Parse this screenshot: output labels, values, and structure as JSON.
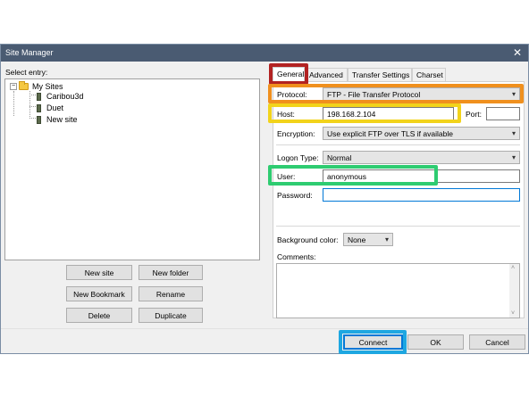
{
  "window": {
    "title": "Site Manager",
    "close_glyph": "✕"
  },
  "left": {
    "select_entry_label": "Select entry:",
    "tree": {
      "root": {
        "label": "My Sites",
        "expander": "−",
        "icon": "folder-icon"
      },
      "children": [
        {
          "label": "Caribou3d",
          "icon": "server-icon"
        },
        {
          "label": "Duet",
          "icon": "server-icon"
        },
        {
          "label": "New site",
          "icon": "server-icon"
        }
      ]
    },
    "buttons": {
      "new_site": "New site",
      "new_folder": "New folder",
      "new_bookmark": "New Bookmark",
      "rename": "Rename",
      "delete": "Delete",
      "duplicate": "Duplicate"
    }
  },
  "tabs": [
    "General",
    "Advanced",
    "Transfer Settings",
    "Charset"
  ],
  "general": {
    "protocol_label": "Protocol:",
    "protocol_value": "FTP - File Transfer Protocol",
    "host_label": "Host:",
    "host_value": "198.168.2.104",
    "port_label": "Port:",
    "port_value": "",
    "encryption_label": "Encryption:",
    "encryption_value": "Use explicit FTP over TLS if available",
    "logon_type_label": "Logon Type:",
    "logon_type_value": "Normal",
    "user_label": "User:",
    "user_value": "anonymous",
    "password_label": "Password:",
    "password_value": "",
    "background_color_label": "Background color:",
    "background_color_value": "None",
    "comments_label": "Comments:",
    "comments_value": ""
  },
  "footer": {
    "connect": "Connect",
    "ok": "OK",
    "cancel": "Cancel"
  },
  "highlights": {
    "tab_general": "#b22222",
    "protocol": "#f0901e",
    "host": "#f2d31b",
    "user": "#2ecc71",
    "connect": "#1ea7e1"
  }
}
